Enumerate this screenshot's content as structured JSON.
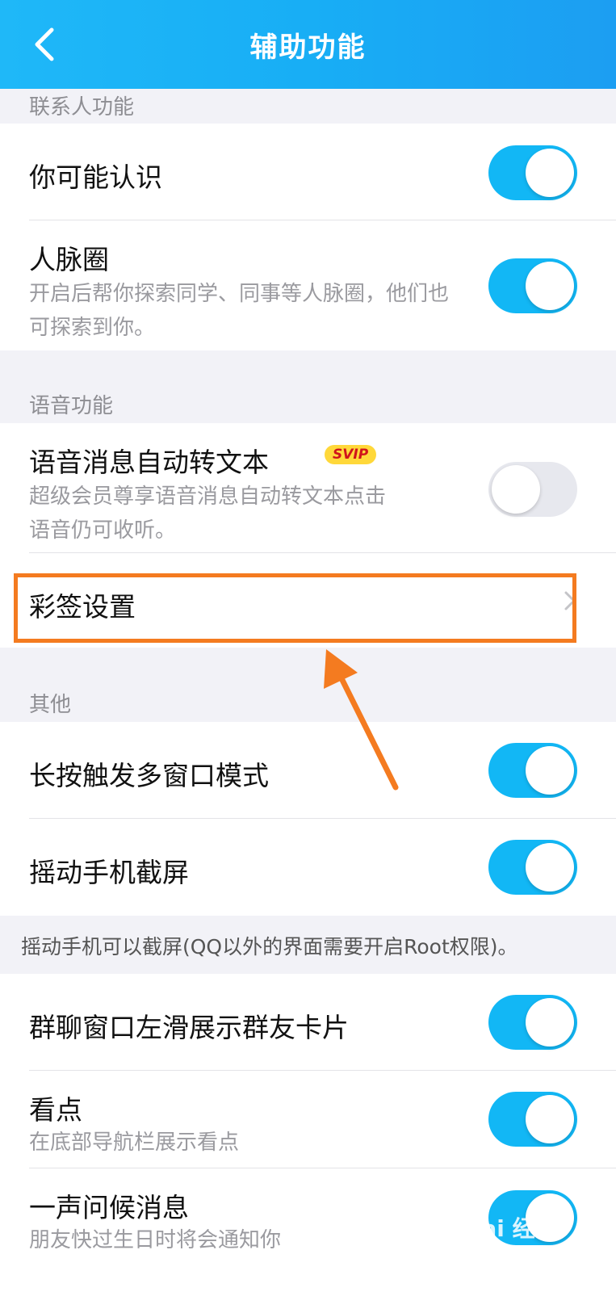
{
  "header": {
    "title": "辅助功能",
    "back_icon": "chevron-left-icon"
  },
  "sections": {
    "contacts": "联系人功能",
    "voice": "语音功能",
    "other": "其他"
  },
  "rows": {
    "may_know": {
      "title": "你可能认识",
      "toggle": "on"
    },
    "network": {
      "title": "人脉圈",
      "desc": "开启后帮你探索同学、同事等人脉圈，他们也可探索到你。",
      "toggle": "on"
    },
    "voice_to_text": {
      "title": "语音消息自动转文本",
      "badge": "SVIP",
      "desc": "超级会员尊享语音消息自动转文本点击语音仍可收听。",
      "toggle": "off"
    },
    "caiqian": {
      "title": "彩签设置",
      "icon": "chevron-right-icon"
    },
    "multi_window": {
      "title": "长按触发多窗口模式",
      "toggle": "on"
    },
    "shake_screenshot": {
      "title": "摇动手机截屏",
      "toggle": "on"
    },
    "group_card": {
      "title": "群聊窗口左滑展示群友卡片",
      "toggle": "on"
    },
    "kandian": {
      "title": "看点",
      "desc": "在底部导航栏展示看点",
      "toggle": "on"
    },
    "greeting": {
      "title": "一声问候消息",
      "desc": "朋友快过生日时将会通知你",
      "toggle": "on"
    }
  },
  "note": "摇动手机可以截屏(QQ以外的界面需要开启Root权限)。",
  "annotation": {
    "color": "#f47b20"
  },
  "watermark": "Bai 经验"
}
